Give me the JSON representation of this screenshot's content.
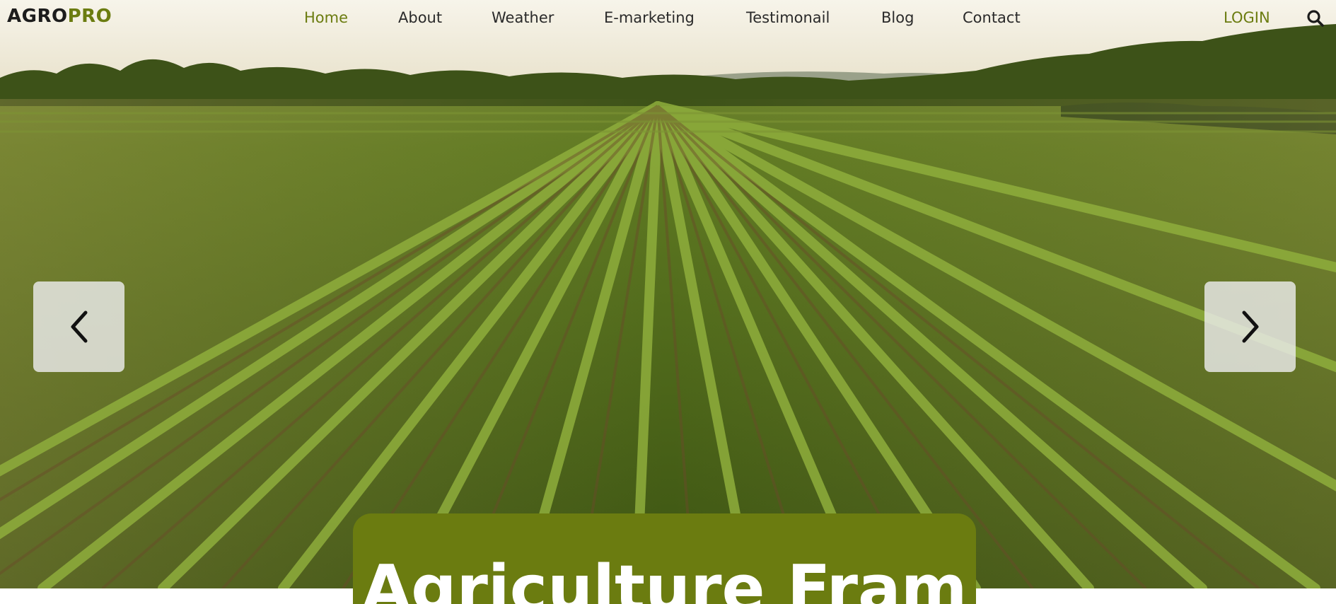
{
  "brand": {
    "logo_part1": "AGRO",
    "logo_part2": "PRO",
    "accent_color": "#6b7c10"
  },
  "nav": {
    "items": [
      {
        "label": "Home",
        "active": true
      },
      {
        "label": "About",
        "active": false
      },
      {
        "label": "Weather",
        "active": false
      },
      {
        "label": "E-marketing",
        "active": false
      },
      {
        "label": "Testimonail",
        "active": false
      },
      {
        "label": "Blog",
        "active": false
      },
      {
        "label": "Contact",
        "active": false
      }
    ],
    "login_label": "LOGIN",
    "search_icon": "search-icon"
  },
  "carousel": {
    "prev_icon": "chevron-left-icon",
    "next_icon": "chevron-right-icon"
  },
  "banner": {
    "title": "Agriculture Fram"
  }
}
